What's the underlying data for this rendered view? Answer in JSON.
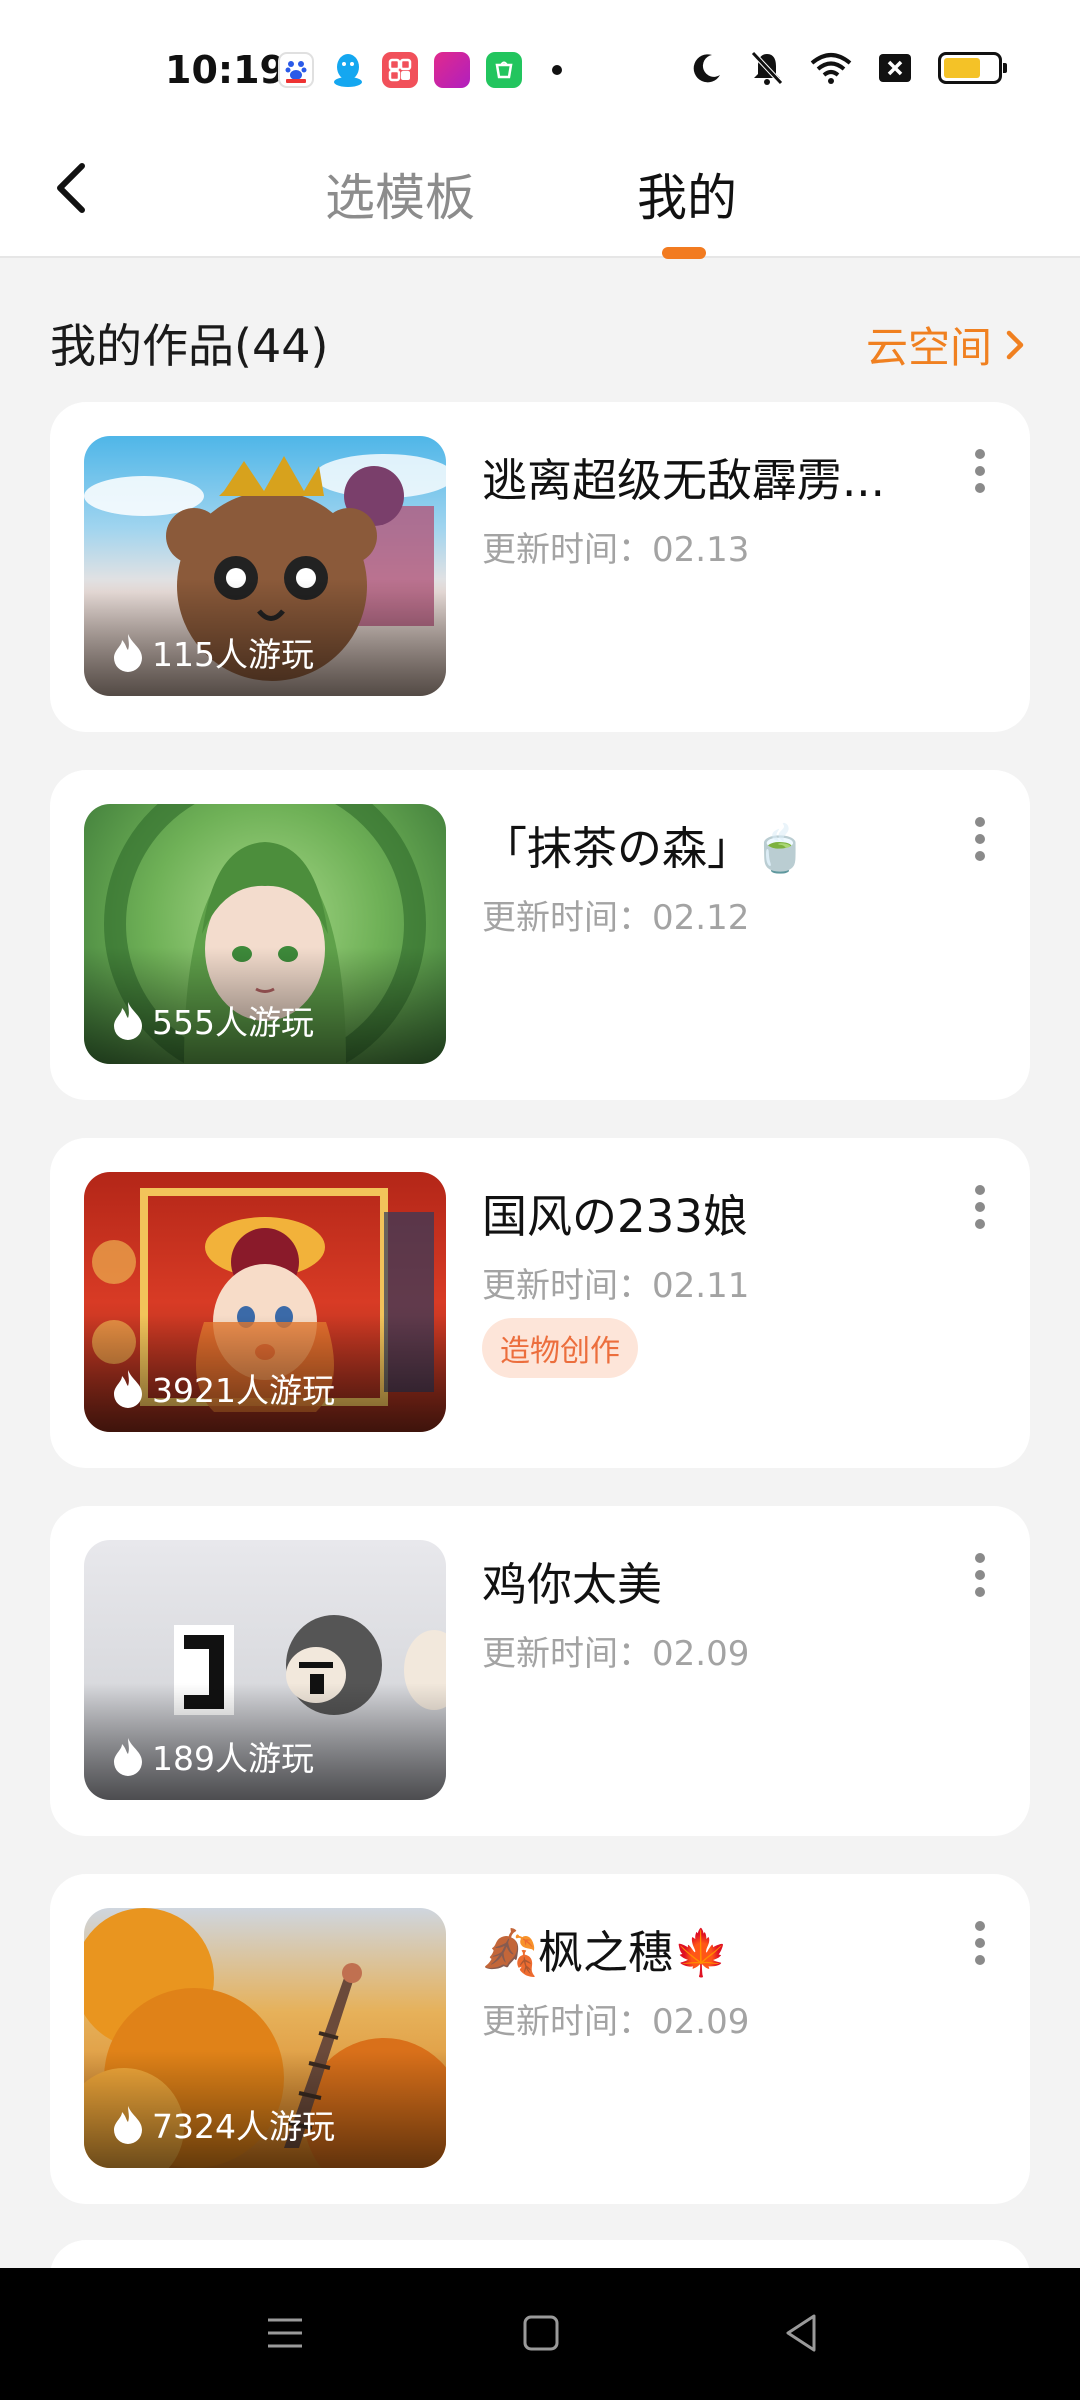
{
  "status_bar": {
    "time": "10:19",
    "app_icons": [
      "baidu-icon",
      "qq-icon",
      "app-icon-orange",
      "app-icon-pink",
      "app-icon-green"
    ],
    "system_icons": [
      "moon-icon",
      "mute-icon",
      "wifi-icon",
      "sim-off-icon",
      "battery-icon"
    ],
    "battery_level": 0.7,
    "battery_color": "#f4c227"
  },
  "header": {
    "tabs": [
      {
        "label": "选模板",
        "active": false
      },
      {
        "label": "我的",
        "active": true
      }
    ],
    "accent_color": "#f27b20"
  },
  "section": {
    "title": "我的作品(44)",
    "cloud_link": "云空间"
  },
  "works": [
    {
      "title": "逃离超级无敌霹雳...",
      "updated": "更新时间：02.13",
      "plays": "115人游玩",
      "tag": ""
    },
    {
      "title": "「抹茶の森」🍵",
      "updated": "更新时间：02.12",
      "plays": "555人游玩",
      "tag": ""
    },
    {
      "title": "国风の233娘",
      "updated": "更新时间：02.11",
      "plays": "3921人游玩",
      "tag": "造物创作"
    },
    {
      "title": "鸡你太美",
      "updated": "更新时间：02.09",
      "plays": "189人游玩",
      "tag": ""
    },
    {
      "title": "🍂枫之穗🍁",
      "updated": "更新时间：02.09",
      "plays": "7324人游玩",
      "tag": ""
    }
  ],
  "nav": {
    "buttons": [
      "menu-icon",
      "home-icon",
      "back-icon"
    ]
  }
}
